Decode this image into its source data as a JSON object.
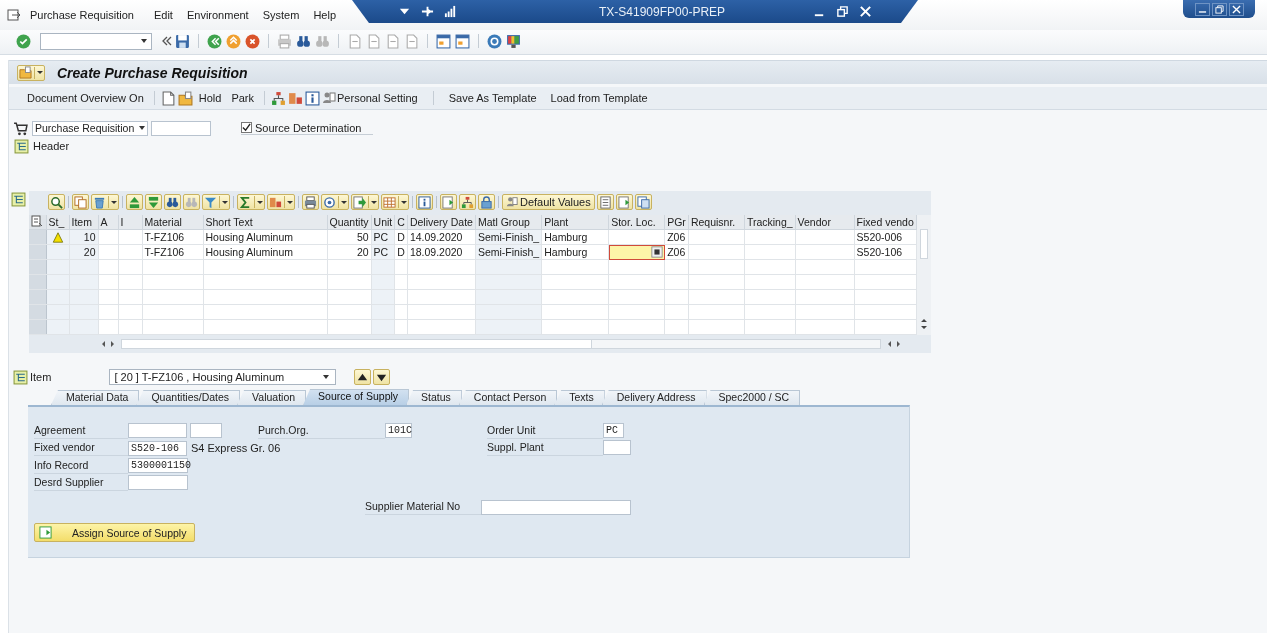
{
  "menu": [
    "Purchase Requisition",
    "Edit",
    "Environment",
    "System",
    "Help"
  ],
  "window": {
    "title": "TX-S41909FP00-PREP"
  },
  "screen_title": "Create Purchase Requisition",
  "app_toolbar": [
    "Document Overview On",
    "Hold",
    "Park",
    "Personal Setting",
    "Save As Template",
    "Load from Template"
  ],
  "document_type": {
    "value": "Purchase Requisition"
  },
  "source_determination": {
    "label": "Source Determination",
    "checked": true
  },
  "header": {
    "label": "Header"
  },
  "grid": {
    "default_values_button": "Default Values",
    "columns": [
      "St_",
      "Item",
      "A",
      "I",
      "Material",
      "Short Text",
      "Quantity",
      "Unit",
      "C",
      "Delivery Date",
      "Matl Group",
      "Plant",
      "Stor. Loc.",
      "PGr",
      "Requisnr.",
      "Tracking_",
      "Vendor",
      "Fixed vendo"
    ],
    "rows": [
      {
        "warning": true,
        "stor_loc_focused": false,
        "cells": {
          "item": "10",
          "material": "T-FZ106",
          "short_text": "Housing Aluminum",
          "quantity": "50",
          "unit": "PC",
          "c": "D",
          "delivery_date": "14.09.2020",
          "matl_group": "Semi-Finish_",
          "plant": "Hamburg",
          "pgr": "Z06",
          "fixed_vendor": "S520-006"
        }
      },
      {
        "warning": false,
        "stor_loc_focused": true,
        "cells": {
          "item": "20",
          "material": "T-FZ106",
          "short_text": "Housing Aluminum",
          "quantity": "20",
          "unit": "PC",
          "c": "D",
          "delivery_date": "18.09.2020",
          "matl_group": "Semi-Finish_",
          "plant": "Hamburg",
          "pgr": "Z06",
          "fixed_vendor": "S520-106"
        }
      }
    ]
  },
  "item_selector": {
    "label": "Item",
    "value": "[ 20 ] T-FZ106 , Housing Aluminum"
  },
  "tabs": [
    {
      "label": "Material Data",
      "selected": false
    },
    {
      "label": "Quantities/Dates",
      "selected": false
    },
    {
      "label": "Valuation",
      "selected": false
    },
    {
      "label": "Source of Supply",
      "selected": true
    },
    {
      "label": "Status",
      "selected": false
    },
    {
      "label": "Contact Person",
      "selected": false
    },
    {
      "label": "Texts",
      "selected": false
    },
    {
      "label": "Delivery Address",
      "selected": false
    },
    {
      "label": "Spec2000 / SC",
      "selected": false
    }
  ],
  "source_of_supply": {
    "agreement": {
      "label": "Agreement"
    },
    "fixed_vendor": {
      "label": "Fixed vendor",
      "value": "S520-106",
      "description": "S4 Express Gr. 06"
    },
    "info_record": {
      "label": "Info Record",
      "value": "5300001150"
    },
    "desired_supplier": {
      "label": "Desrd Supplier"
    },
    "purch_org": {
      "label": "Purch.Org.",
      "value": "101C"
    },
    "order_unit": {
      "label": "Order Unit",
      "value": "PC"
    },
    "supplying_plant": {
      "label": "Suppl. Plant"
    },
    "supplier_material_no": {
      "label": "Supplier Material No"
    },
    "assign_button": "Assign Source of Supply"
  }
}
